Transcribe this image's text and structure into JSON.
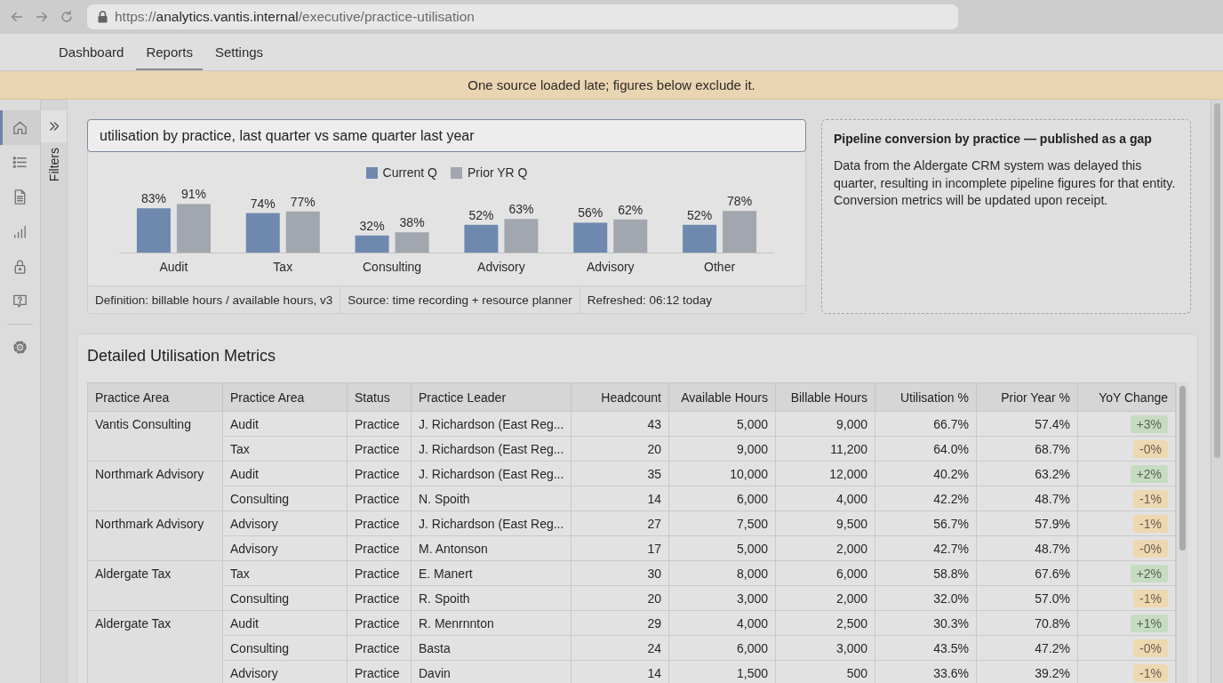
{
  "browser": {
    "url": {
      "scheme": "https://",
      "host": "analytics.vantis.internal",
      "path": "/executive/practice-utilisation"
    }
  },
  "tabs": [
    {
      "label": "Dashboard",
      "selected": false
    },
    {
      "label": "Reports",
      "selected": true
    },
    {
      "label": "Settings",
      "selected": false
    }
  ],
  "banner": {
    "text": "One source loaded late; figures below exclude it."
  },
  "nav_rail": {
    "items": [
      {
        "selected": true
      },
      {
        "selected": false
      },
      {
        "selected": false
      },
      {
        "selected": false
      },
      {
        "selected": false
      },
      {
        "selected": false
      },
      {
        "selected": false
      }
    ]
  },
  "filters_panel": {
    "label": "Filters"
  },
  "query": {
    "value": "utilisation by practice, last quarter vs same quarter last year"
  },
  "chart_card": {
    "chart_data": {
      "type": "bar",
      "categories": [
        "Audit",
        "Tax",
        "Consulting",
        "Advisory",
        "Advisory",
        "Other"
      ],
      "series": [
        {
          "name": "Current Q",
          "color": "#6f89ae",
          "values": [
            83,
            74,
            32,
            52,
            56,
            52
          ],
          "value_labels": [
            "83%",
            "74%",
            "32%",
            "52%",
            "56%",
            "52%"
          ]
        },
        {
          "name": "Prior YR Q",
          "color": "#a2a6ae",
          "values": [
            91,
            77,
            38,
            63,
            62,
            78
          ],
          "value_labels": [
            "91%",
            "77%",
            "38%",
            "63%",
            "62%",
            "78%"
          ]
        }
      ],
      "data_labels": true
    },
    "footer": [
      "Definition: billable hours / available hours, v3",
      "Source: time recording + resource planner",
      "Refreshed: 06:12 today"
    ]
  },
  "gap_notice": {
    "title": "Pipeline conversion by practice — published as a gap",
    "body": "Data from the Aldergate CRM system was delayed this quarter, resulting in incomplete pipeline figures for that entity. Conversion metrics will be updated upon receipt."
  },
  "metrics": {
    "title": "Detailed Utilisation Metrics",
    "columns": [
      "Practice Area",
      "Practice Area",
      "Status",
      "Practice Leader",
      "Headcount",
      "Available Hours",
      "Billable Hours",
      "Utilisation %",
      "Prior Year %",
      "YoY Change"
    ],
    "groups": [
      {
        "practice": "Vantis Consulting",
        "rows": [
          {
            "cells": [
              "Audit",
              "Practice",
              "J. Richardson (East Reg...",
              "43",
              "5,000",
              "9,000",
              "66.7%",
              "57.4%"
            ],
            "yoy": {
              "text": "+3%",
              "color": "#c6dcc1"
            }
          },
          {
            "cells": [
              "Tax",
              "Practice",
              "J. Richardson (East Reg...",
              "20",
              "9,000",
              "11,200",
              "64.0%",
              "68.7%"
            ],
            "yoy": {
              "text": "-0%",
              "color": "#edd8b1"
            }
          }
        ]
      },
      {
        "practice": "Northmark Advisory",
        "rows": [
          {
            "cells": [
              "Audit",
              "Practice",
              "J. Richardson (East Reg...",
              "35",
              "10,000",
              "12,000",
              "40.2%",
              "63.2%"
            ],
            "yoy": {
              "text": "+2%",
              "color": "#c6dcc1"
            }
          },
          {
            "cells": [
              "Consulting",
              "Practice",
              "N. Spoith",
              "14",
              "6,000",
              "4,000",
              "42.2%",
              "48.7%"
            ],
            "yoy": {
              "text": "-1%",
              "color": "#edd8b1"
            }
          }
        ]
      },
      {
        "practice": "Northmark Advisory",
        "rows": [
          {
            "cells": [
              "Advisory",
              "Practice",
              "J. Richardson (East Reg...",
              "27",
              "7,500",
              "9,500",
              "56.7%",
              "57.9%"
            ],
            "yoy": {
              "text": "-1%",
              "color": "#edd8b1"
            }
          },
          {
            "cells": [
              "Advisory",
              "Practice",
              "M. Antonson",
              "17",
              "5,000",
              "2,000",
              "42.7%",
              "48.7%"
            ],
            "yoy": {
              "text": "-0%",
              "color": "#edd8b1"
            }
          }
        ]
      },
      {
        "practice": "Aldergate Tax",
        "rows": [
          {
            "cells": [
              "Tax",
              "Practice",
              "E. Manert",
              "30",
              "8,000",
              "6,000",
              "58.8%",
              "67.6%"
            ],
            "yoy": {
              "text": "+2%",
              "color": "#c6dcc1"
            }
          },
          {
            "cells": [
              "Consulting",
              "Practice",
              "R. Spoith",
              "20",
              "3,000",
              "2,000",
              "32.0%",
              "57.0%"
            ],
            "yoy": {
              "text": "-1%",
              "color": "#edd8b1"
            }
          }
        ]
      },
      {
        "practice": "Aldergate Tax",
        "rows": [
          {
            "cells": [
              "Audit",
              "Practice",
              "R. Menrnnton",
              "29",
              "4,000",
              "2,500",
              "30.3%",
              "70.8%"
            ],
            "yoy": {
              "text": "+1%",
              "color": "#c6dcc1"
            }
          },
          {
            "cells": [
              "Consulting",
              "Practice",
              "Basta",
              "24",
              "6,000",
              "3,000",
              "43.5%",
              "47.2%"
            ],
            "yoy": {
              "text": "-0%",
              "color": "#edd8b1"
            }
          },
          {
            "cells": [
              "Advisory",
              "Practice",
              "Davin",
              "14",
              "1,500",
              "500",
              "33.6%",
              "39.2%"
            ],
            "yoy": {
              "text": "-1%",
              "color": "#edd8b1"
            }
          }
        ]
      }
    ]
  }
}
